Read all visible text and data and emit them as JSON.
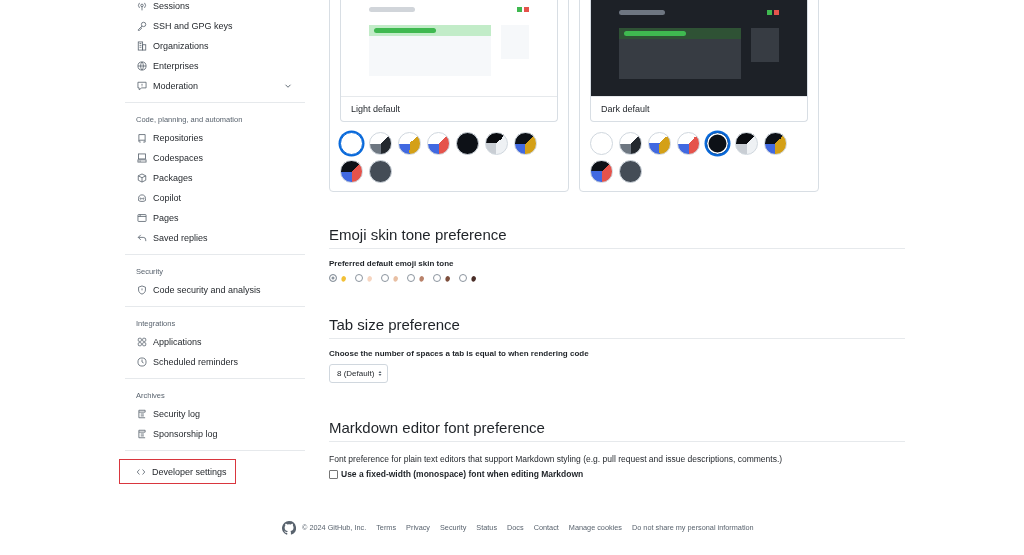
{
  "sidebar": {
    "sections": [
      {
        "items": [
          {
            "label": "Sessions",
            "expandable": false,
            "highlighted": false
          },
          {
            "label": "SSH and GPG keys",
            "expandable": false,
            "highlighted": false
          },
          {
            "label": "Organizations",
            "expandable": false,
            "highlighted": false
          },
          {
            "label": "Enterprises",
            "expandable": false,
            "highlighted": false
          },
          {
            "label": "Moderation",
            "expandable": true,
            "highlighted": false
          }
        ]
      },
      {
        "title": "Code, planning, and automation",
        "items": [
          {
            "label": "Repositories",
            "expandable": false,
            "highlighted": false
          },
          {
            "label": "Codespaces",
            "expandable": false,
            "highlighted": false
          },
          {
            "label": "Packages",
            "expandable": false,
            "highlighted": false
          },
          {
            "label": "Copilot",
            "expandable": false,
            "highlighted": false
          },
          {
            "label": "Pages",
            "expandable": false,
            "highlighted": false
          },
          {
            "label": "Saved replies",
            "expandable": false,
            "highlighted": false
          }
        ]
      },
      {
        "title": "Security",
        "items": [
          {
            "label": "Code security and analysis",
            "expandable": false,
            "highlighted": false
          }
        ]
      },
      {
        "title": "Integrations",
        "items": [
          {
            "label": "Applications",
            "expandable": false,
            "highlighted": false
          },
          {
            "label": "Scheduled reminders",
            "expandable": false,
            "highlighted": false
          }
        ]
      },
      {
        "title": "Archives",
        "items": [
          {
            "label": "Security log",
            "expandable": false,
            "highlighted": false
          },
          {
            "label": "Sponsorship log",
            "expandable": false,
            "highlighted": false
          }
        ]
      },
      {
        "items": [
          {
            "label": "Developer settings",
            "expandable": false,
            "highlighted": true
          }
        ]
      }
    ]
  },
  "theme_cards": [
    {
      "label": "Light default",
      "kind": "light",
      "swatches": [
        {
          "kind": "light",
          "selected": true
        },
        {
          "kind": "light_high_contrast",
          "selected": false
        },
        {
          "kind": "light_colorblind",
          "selected": false
        },
        {
          "kind": "light_tritanopia",
          "selected": false
        },
        {
          "kind": "dark",
          "selected": false
        },
        {
          "kind": "dark_high_contrast",
          "selected": false
        },
        {
          "kind": "dark_colorblind",
          "selected": false
        },
        {
          "kind": "dark_tritanopia",
          "selected": false
        },
        {
          "kind": "dark_dimmed",
          "selected": false
        }
      ]
    },
    {
      "label": "Dark default",
      "kind": "dark",
      "swatches": [
        {
          "kind": "light",
          "selected": false
        },
        {
          "kind": "light_high_contrast",
          "selected": false
        },
        {
          "kind": "light_colorblind",
          "selected": false
        },
        {
          "kind": "light_tritanopia",
          "selected": false
        },
        {
          "kind": "dark",
          "selected": true
        },
        {
          "kind": "dark_high_contrast",
          "selected": false
        },
        {
          "kind": "dark_colorblind",
          "selected": false
        },
        {
          "kind": "dark_tritanopia",
          "selected": false
        },
        {
          "kind": "dark_dimmed",
          "selected": false
        }
      ]
    }
  ],
  "emoji_section": {
    "heading": "Emoji skin tone preference",
    "label": "Preferred default emoji skin tone",
    "tones": [
      {
        "color": "#f2c037",
        "selected": true
      },
      {
        "color": "#f6d5c0",
        "selected": false
      },
      {
        "color": "#e8bfa3",
        "selected": false
      },
      {
        "color": "#b9826a",
        "selected": false
      },
      {
        "color": "#7d4e3c",
        "selected": false
      },
      {
        "color": "#4a2e28",
        "selected": false
      }
    ]
  },
  "tab_section": {
    "heading": "Tab size preference",
    "label": "Choose the number of spaces a tab is equal to when rendering code",
    "value": "8 (Default)"
  },
  "markdown_section": {
    "heading": "Markdown editor font preference",
    "description": "Font preference for plain text editors that support Markdown styling (e.g. pull request and issue descriptions, comments.)",
    "checkbox": {
      "label": "Use a fixed-width (monospace) font when editing Markdown",
      "checked": false
    }
  },
  "footer": {
    "copyright": "© 2024 GitHub, Inc.",
    "links": [
      "Terms",
      "Privacy",
      "Security",
      "Status",
      "Docs",
      "Contact",
      "Manage cookies",
      "Do not share my personal information"
    ]
  }
}
